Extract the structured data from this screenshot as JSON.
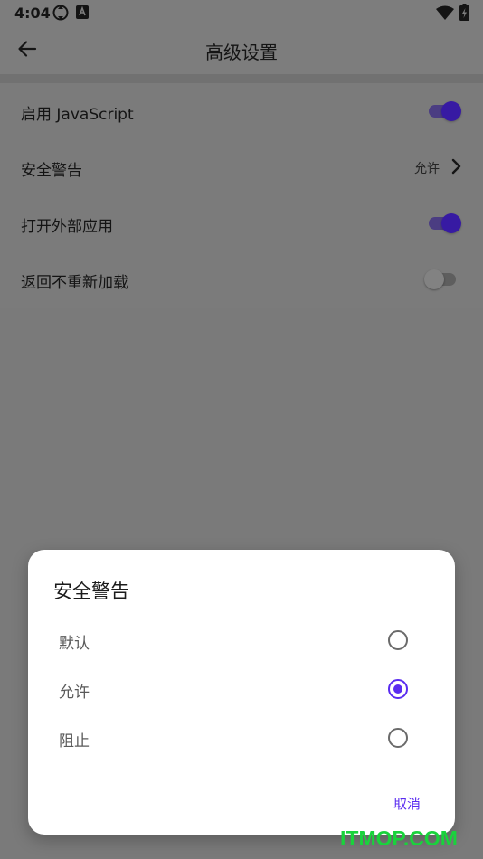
{
  "status_bar": {
    "time": "4:04",
    "icons": [
      "sync-icon",
      "keyboard-a-icon",
      "wifi-icon",
      "battery-charging-icon"
    ]
  },
  "app_bar": {
    "back_icon": "arrow-left-icon",
    "title": "高级设置"
  },
  "settings": {
    "items": [
      {
        "label": "启用 JavaScript",
        "type": "toggle",
        "on": true
      },
      {
        "label": "安全警告",
        "type": "value",
        "value": "允许",
        "icon": "chevron-right-icon"
      },
      {
        "label": "打开外部应用",
        "type": "toggle",
        "on": true
      },
      {
        "label": "返回不重新加载",
        "type": "toggle",
        "on": false
      }
    ]
  },
  "dialog": {
    "title": "安全警告",
    "options": [
      {
        "label": "默认",
        "selected": false
      },
      {
        "label": "允许",
        "selected": true
      },
      {
        "label": "阻止",
        "selected": false
      }
    ],
    "cancel_label": "取消"
  },
  "watermark": "ITMOP.COM",
  "colors": {
    "accent": "#5a2cf0",
    "toggle_on_thumb": "#371aa3",
    "watermark": "#19d33c"
  }
}
